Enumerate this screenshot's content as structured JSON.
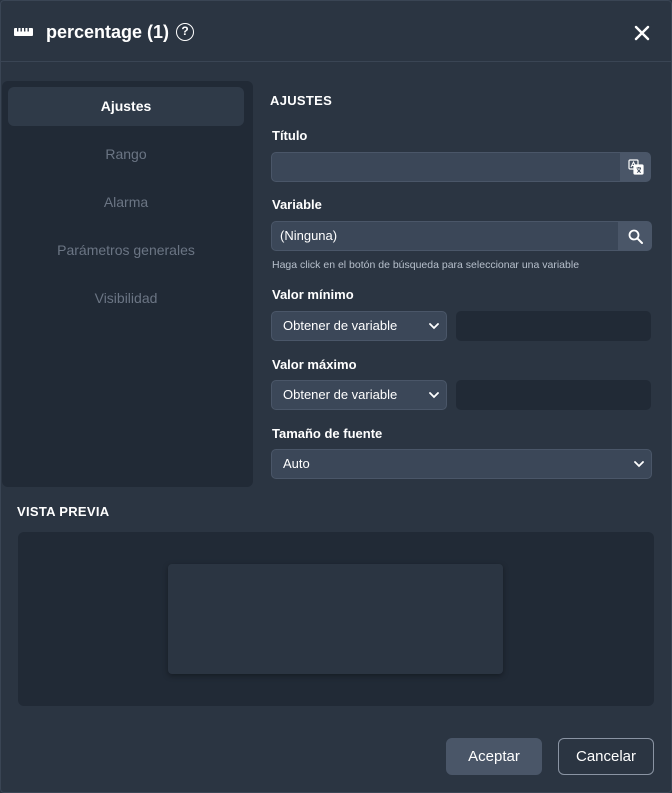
{
  "dialog": {
    "title": "percentage (1)",
    "help_symbol": "?"
  },
  "sidebar": {
    "items": [
      {
        "label": "Ajustes",
        "active": true
      },
      {
        "label": "Rango",
        "active": false
      },
      {
        "label": "Alarma",
        "active": false
      },
      {
        "label": "Parámetros generales",
        "active": false
      },
      {
        "label": "Visibilidad",
        "active": false
      }
    ]
  },
  "settings": {
    "heading": "AJUSTES",
    "titulo": {
      "label": "Título",
      "value": ""
    },
    "variable": {
      "label": "Variable",
      "value": "(Ninguna)",
      "help": "Haga click en el botón de búsqueda para seleccionar una variable"
    },
    "valor_minimo": {
      "label": "Valor mínimo",
      "select_value": "Obtener de variable",
      "value": ""
    },
    "valor_maximo": {
      "label": "Valor máximo",
      "select_value": "Obtener de variable",
      "value": ""
    },
    "tamano_fuente": {
      "label": "Tamaño de fuente",
      "select_value": "Auto"
    }
  },
  "preview": {
    "heading": "VISTA PREVIA"
  },
  "footer": {
    "accept_label": "Aceptar",
    "cancel_label": "Cancelar"
  },
  "icons": {
    "header": "ruler-icon",
    "help": "help-circle-icon",
    "close": "close-icon",
    "translate": "translate-icon",
    "search": "search-icon",
    "dropdown": "chevron-down-icon"
  },
  "colors": {
    "background": "#2b3542",
    "panel": "#212a36",
    "input": "#3b4758",
    "button": "#4a5668"
  }
}
